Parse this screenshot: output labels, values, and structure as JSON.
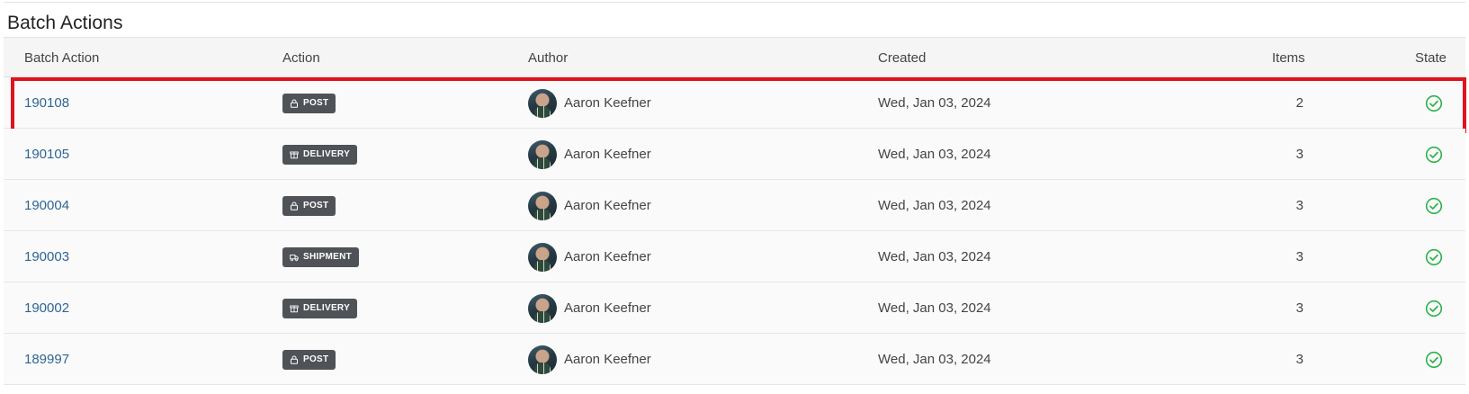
{
  "page": {
    "title": "Batch Actions"
  },
  "columns": {
    "batch_action": "Batch Action",
    "action": "Action",
    "author": "Author",
    "created": "Created",
    "items": "Items",
    "state": "State"
  },
  "colors": {
    "link": "#2f6593",
    "badge_bg": "#4f5256",
    "state_ok": "#2bb24c",
    "highlight_border": "#e0141e"
  },
  "rows": [
    {
      "id": "190108",
      "action": "POST",
      "action_icon": "lock-icon",
      "author": "Aaron Keefner",
      "created": "Wed, Jan 03, 2024",
      "items": "2",
      "state": "check-circle-icon",
      "highlighted": true
    },
    {
      "id": "190105",
      "action": "DELIVERY",
      "action_icon": "box-icon",
      "author": "Aaron Keefner",
      "created": "Wed, Jan 03, 2024",
      "items": "3",
      "state": "check-circle-icon",
      "highlighted": false
    },
    {
      "id": "190004",
      "action": "POST",
      "action_icon": "lock-icon",
      "author": "Aaron Keefner",
      "created": "Wed, Jan 03, 2024",
      "items": "3",
      "state": "check-circle-icon",
      "highlighted": false
    },
    {
      "id": "190003",
      "action": "SHIPMENT",
      "action_icon": "truck-icon",
      "author": "Aaron Keefner",
      "created": "Wed, Jan 03, 2024",
      "items": "3",
      "state": "check-circle-icon",
      "highlighted": false
    },
    {
      "id": "190002",
      "action": "DELIVERY",
      "action_icon": "box-icon",
      "author": "Aaron Keefner",
      "created": "Wed, Jan 03, 2024",
      "items": "3",
      "state": "check-circle-icon",
      "highlighted": false
    },
    {
      "id": "189997",
      "action": "POST",
      "action_icon": "lock-icon",
      "author": "Aaron Keefner",
      "created": "Wed, Jan 03, 2024",
      "items": "3",
      "state": "check-circle-icon",
      "highlighted": false
    }
  ]
}
